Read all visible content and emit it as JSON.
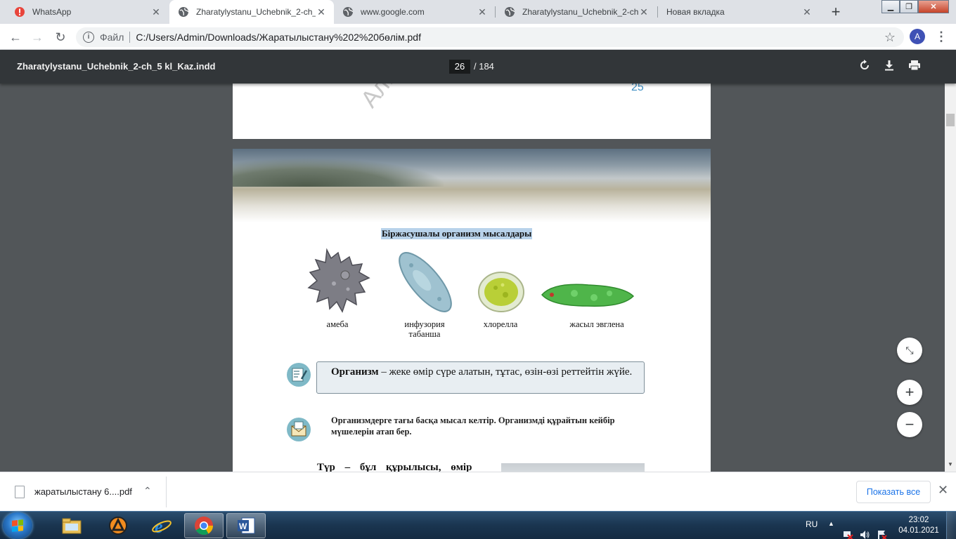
{
  "browser": {
    "tabs": [
      {
        "title": "WhatsApp",
        "icon": "whatsapp-alert-icon"
      },
      {
        "title": "Zharatylystanu_Uchebnik_2-ch_",
        "icon": "globe-icon",
        "active": true
      },
      {
        "title": "www.google.com",
        "icon": "globe-icon"
      },
      {
        "title": "Zharatylystanu_Uchebnik_2-ch_",
        "icon": "globe-icon"
      },
      {
        "title": "Новая вкладка",
        "icon": ""
      }
    ],
    "new_tab_symbol": "+",
    "omnibox": {
      "scheme_label": "Файл",
      "url": "C:/Users/Admin/Downloads/Жаратылыстану%202%20бөлім.pdf"
    },
    "profile_initial": "A"
  },
  "pdf_viewer": {
    "title": "Zharatylystanu_Uchebnik_2-ch_5 kl_Kaz.indd",
    "current_page": "26",
    "total_pages": "/ 184",
    "prev_page": {
      "page_number": "25",
      "watermark": "Алматы"
    },
    "page": {
      "caption_title": "Біржасушалы организм мысалдары",
      "organisms": [
        {
          "label": "амеба",
          "color": "#7d7d85"
        },
        {
          "label": "инфузория\nтабанша",
          "color": "#9fc2d0"
        },
        {
          "label": "хлорелла",
          "color": "#b9cf37"
        },
        {
          "label": "жасыл эвглена",
          "color": "#4fb54a"
        }
      ],
      "definition": {
        "term": "Организм",
        "text": " – жеке өмір сүре алатын, тұтас, өзін-өзі реттейтін жүйе."
      },
      "task_text": "Организмдерге тағы басқа мысал келтір. Организмді құрайтын кейбір мүшелерін атап бер.",
      "cut_line": "Түр – бұл құрылысы, өмір"
    },
    "zoom_controls": [
      "fit-page",
      "zoom-in",
      "zoom-out"
    ]
  },
  "download_shelf": {
    "file_name": "жаратылыстану 6....pdf",
    "show_all_label": "Показать все"
  },
  "taskbar": {
    "language": "RU",
    "time": "23:02",
    "date": "04.01.2021",
    "apps": [
      "file-explorer-icon",
      "avast-icon",
      "internet-explorer-icon",
      "chrome-icon",
      "word-icon"
    ]
  },
  "colors": {
    "pdf_toolbar": "#323639",
    "viewer_background": "#525659",
    "caption_highlight": "#b8d2ea",
    "link_blue": "#1a73e8"
  }
}
